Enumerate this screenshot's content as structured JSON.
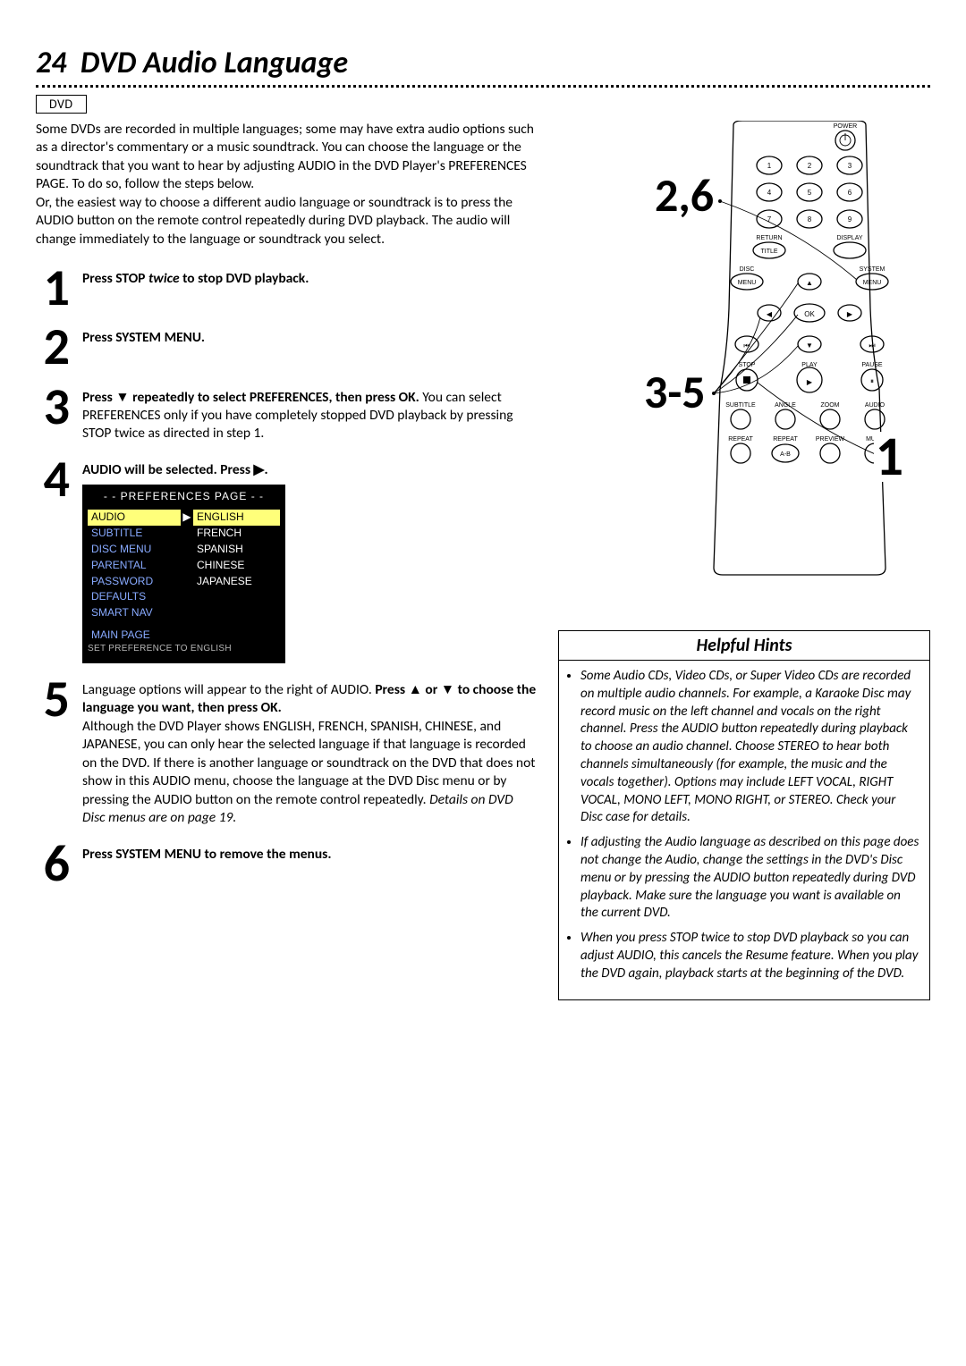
{
  "page_number": "24",
  "title": "DVD Audio Language",
  "badge": "DVD",
  "intro_p1": "Some DVDs are recorded in multiple languages; some may have extra audio options such as a director's commentary or a music soundtrack. You can choose the language or the soundtrack that you want to hear by adjusting AUDIO in the DVD Player's PREFERENCES PAGE. To do so, follow the steps below.",
  "intro_p2": "Or, the easiest way to choose a different audio language or soundtrack is to press the AUDIO button on the remote control repeatedly during DVD playback. The audio will change immediately to the language or soundtrack you select.",
  "steps": {
    "s1_a": "Press STOP ",
    "s1_b": "twice",
    "s1_c": " to stop DVD playback.",
    "s2": "Press SYSTEM MENU.",
    "s3_a": "Press ▼ repeatedly to select PREFERENCES, then press OK.",
    "s3_b": " You can select PREFERENCES only if you have completely stopped DVD playback by pressing STOP twice as directed in step 1.",
    "s4": "AUDIO will be selected. Press ▶.",
    "s5_a": "Language options will appear to the right of AUDIO. ",
    "s5_b": "Press ▲ or ▼ to choose the language you want, then press OK.",
    "s5_c": "Although the DVD Player shows ENGLISH, FRENCH, SPANISH, CHINESE, and JAPANESE, you can only hear the selected language if that language is recorded on the DVD. If there is another language or soundtrack on the DVD that does not show in this AUDIO menu, choose the language at the DVD Disc menu or by pressing the AUDIO button on the remote control repeatedly. ",
    "s5_d": "Details on DVD Disc menus are on page 19.",
    "s6": "Press SYSTEM MENU to remove the menus."
  },
  "pref": {
    "title": "- -  PREFERENCES PAGE  - -",
    "left": [
      "AUDIO",
      "SUBTITLE",
      "DISC MENU",
      "PARENTAL",
      "PASSWORD",
      "DEFAULTS",
      "SMART NAV"
    ],
    "right": [
      "ENGLISH",
      "FRENCH",
      "SPANISH",
      "CHINESE",
      "JAPANESE"
    ],
    "footer1": "MAIN PAGE",
    "footer2": "SET PREFERENCE TO ENGLISH"
  },
  "remote": {
    "power": "POWER",
    "numbers": [
      "1",
      "2",
      "3",
      "4",
      "5",
      "6",
      "7",
      "8",
      "9"
    ],
    "return": "RETURN",
    "display": "DISPLAY",
    "title": "TITLE",
    "disc": "DISC",
    "menu": "MENU",
    "system": "SYSTEM",
    "ok": "OK",
    "stop": "STOP",
    "play": "PLAY",
    "pause": "PAUSE",
    "subtitle": "SUBTITLE",
    "angle": "ANGLE",
    "zoom": "ZOOM",
    "audio": "AUDIO",
    "repeat": "REPEAT",
    "repab": "REPEAT",
    "preview": "PREVIEW",
    "mute": "MUTE",
    "ab": "A-B"
  },
  "callouts": {
    "c26": "2,6",
    "c35": "3-5",
    "c1": "1"
  },
  "hints_title": "Helpful Hints",
  "hints": [
    "Some Audio CDs, Video CDs, or Super Video CDs are recorded on multiple audio channels. For example, a Karaoke Disc may record music on the left channel and vocals on the right channel. Press the AUDIO button repeatedly during playback to choose an audio channel. Choose STEREO to hear both channels simultaneously (for example, the music and the vocals together). Options may include LEFT VOCAL, RIGHT VOCAL, MONO LEFT, MONO RIGHT, or STEREO. Check your Disc case for details.",
    "If adjusting the Audio language as described on this page does not change the Audio, change the settings in the DVD's Disc menu or by pressing the AUDIO button repeatedly during DVD playback. Make sure the language you want is available on the current DVD.",
    "When you press STOP twice to stop DVD playback so you can adjust AUDIO, this cancels the Resume feature. When you play the DVD again, playback starts at the beginning of the DVD."
  ]
}
